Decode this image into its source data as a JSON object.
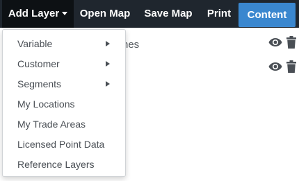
{
  "navbar": {
    "add_layer": "Add Layer",
    "open_map": "Open Map",
    "save_map": "Save Map",
    "print": "Print",
    "content": "Content"
  },
  "background": {
    "partial_text": "nes"
  },
  "add_layer_menu": {
    "items": [
      {
        "label": "Variable",
        "has_submenu": true
      },
      {
        "label": "Customer",
        "has_submenu": true
      },
      {
        "label": "Segments",
        "has_submenu": true
      },
      {
        "label": "My Locations",
        "has_submenu": false
      },
      {
        "label": "My Trade Areas",
        "has_submenu": false
      },
      {
        "label": "Licensed Point Data",
        "has_submenu": false
      },
      {
        "label": "Reference Layers",
        "has_submenu": false
      }
    ]
  },
  "layer_rows": [
    {
      "icons": [
        "eye-icon",
        "trash-icon"
      ]
    },
    {
      "icons": [
        "eye-icon",
        "trash-icon"
      ]
    }
  ],
  "colors": {
    "navbar_bg": "#1f262e",
    "add_layer_active_bg": "#0d1114",
    "content_button_bg": "#3a87cf",
    "icon_color": "#4a4f55"
  }
}
